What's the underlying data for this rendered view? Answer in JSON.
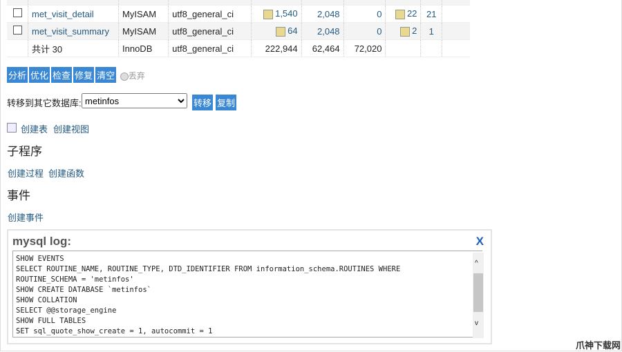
{
  "table": {
    "rows": [
      {
        "name": "met_visit_detail",
        "engine": "MyISAM",
        "collation": "utf8_general_ci",
        "rows": "1,540",
        "size": "2,048",
        "overhead": "0",
        "c1": "22",
        "c2": "21"
      },
      {
        "name": "met_visit_summary",
        "engine": "MyISAM",
        "collation": "utf8_general_ci",
        "rows": "64",
        "size": "2,048",
        "overhead": "0",
        "c1": "2",
        "c2": "1"
      }
    ],
    "total": {
      "label": "共计 30",
      "engine": "InnoDB",
      "collation": "utf8_general_ci",
      "rows": "222,944",
      "size": "62,464",
      "overhead": "72,020"
    }
  },
  "actions": {
    "analyze": "分析",
    "optimize": "优化",
    "check": "检查",
    "repair": "修复",
    "empty": "清空",
    "drop": "丢弃"
  },
  "move": {
    "label": "转移到其它数据库:",
    "selected": "metinfos",
    "move_btn": "转移",
    "copy_btn": "复制"
  },
  "create": {
    "table": "创建表",
    "view": "创建视图"
  },
  "routines": {
    "heading": "子程序",
    "proc": "创建过程",
    "func": "创建函数"
  },
  "events": {
    "heading": "事件",
    "create": "创建事件"
  },
  "log": {
    "title": "mysql log:",
    "close": "X",
    "text": "SHOW EVENTS\nSELECT ROUTINE_NAME, ROUTINE_TYPE, DTD_IDENTIFIER FROM information_schema.ROUTINES WHERE\nROUTINE_SCHEMA = 'metinfos'\nSHOW CREATE DATABASE `metinfos`\nSHOW COLLATION\nSELECT @@storage_engine\nSHOW FULL TABLES\nSET sql_quote_show_create = 1, autocommit = 1"
  },
  "watermark": "爪神下载网"
}
